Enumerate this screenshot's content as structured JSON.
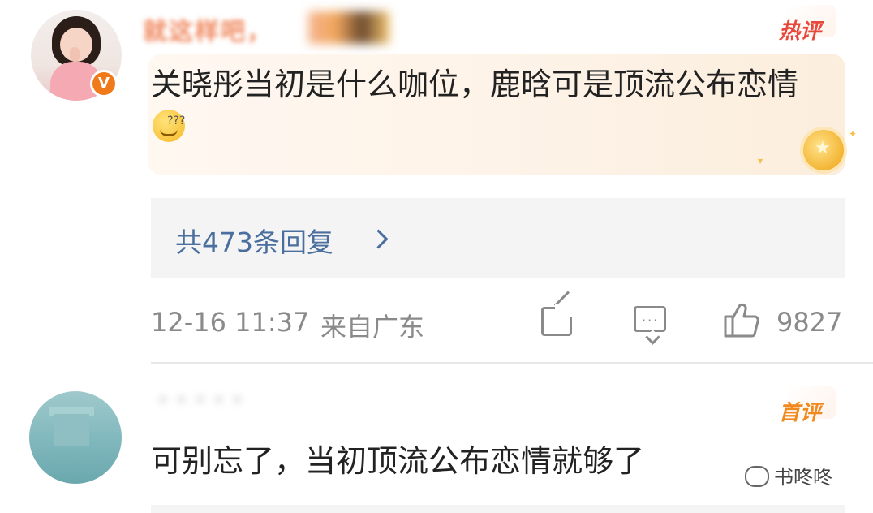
{
  "comments": [
    {
      "author": "就这样吧，",
      "tag": "热评",
      "text": "关晓彤当初是什么咖位，鹿晗可是顶流公布恋情",
      "replies_label": "共473条回复",
      "time": "12-16 11:37",
      "location": "来自广东",
      "likes": "9827",
      "verified_badge": "V"
    },
    {
      "author": "· · · · ·",
      "tag": "首评",
      "text": "可别忘了，当初顶流公布恋情就够了"
    }
  ],
  "watermark": "书咚咚",
  "icons": {
    "share": "share-icon",
    "comment": "comment-icon",
    "like": "like-icon",
    "reply_chevron": "chevron-right-icon",
    "emoji": "smirk-emoji-icon",
    "medal": "star-medal-icon"
  },
  "colors": {
    "hot_tag": "#e8473b",
    "first_tag": "#f08a1e",
    "link": "#4a6f9e",
    "meta": "#8a8a8a",
    "highlight": "#fdf2e6",
    "verified": "#f07a1a"
  }
}
